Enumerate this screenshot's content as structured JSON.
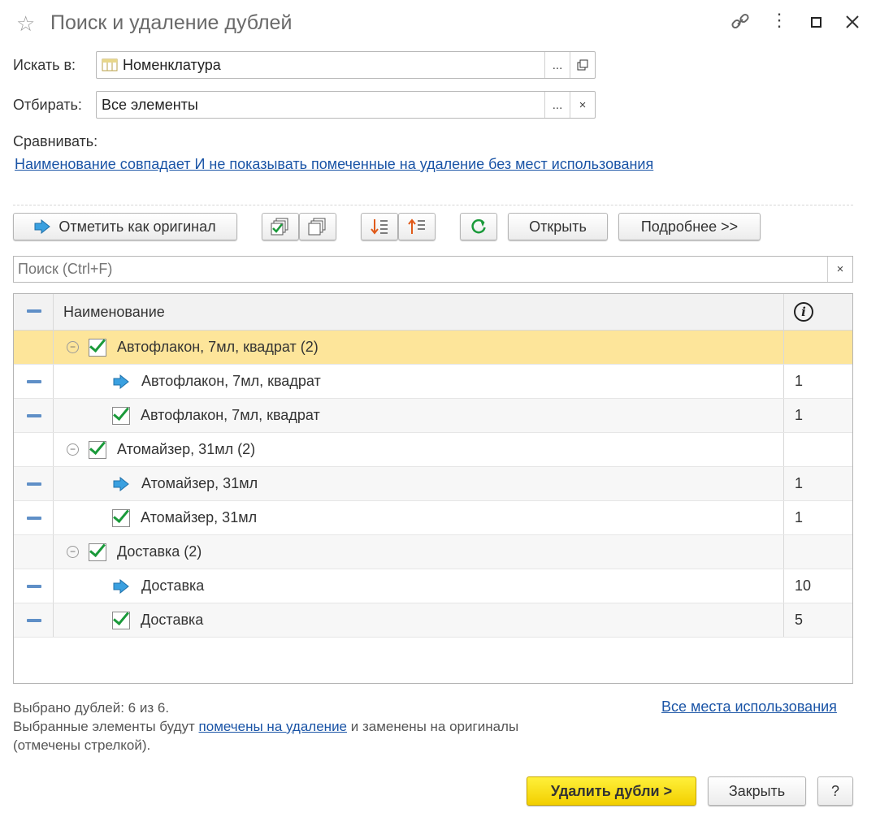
{
  "window": {
    "title": "Поиск и удаление дублей"
  },
  "search_in": {
    "label": "Искать в:",
    "value": "Номенклатура",
    "select_btn": "..."
  },
  "filter": {
    "label": "Отбирать:",
    "value": "Все элементы",
    "select_btn": "...",
    "clear_btn": "×"
  },
  "compare": {
    "label": "Сравнивать:",
    "rule_link": "Наименование совпадает И не показывать помеченные на удаление без мест использования"
  },
  "toolbar": {
    "mark_original": "Отметить как оригинал",
    "open": "Открыть",
    "more": "Подробнее >>"
  },
  "search_box": {
    "placeholder": "Поиск (Ctrl+F)",
    "clear": "×"
  },
  "table": {
    "header_name": "Наименование",
    "rows": [
      {
        "kind": "group",
        "text": "Автофлакон, 7мл, квадрат (2)",
        "count": ""
      },
      {
        "kind": "original",
        "text": "Автофлакон, 7мл, квадрат",
        "count": "1"
      },
      {
        "kind": "duplicate",
        "text": "Автофлакон, 7мл, квадрат",
        "count": "1"
      },
      {
        "kind": "group",
        "text": "Атомайзер, 31мл (2)",
        "count": ""
      },
      {
        "kind": "original",
        "text": "Атомайзер, 31мл",
        "count": "1"
      },
      {
        "kind": "duplicate",
        "text": "Атомайзер, 31мл",
        "count": "1"
      },
      {
        "kind": "group",
        "text": "Доставка (2)",
        "count": ""
      },
      {
        "kind": "original",
        "text": "Доставка",
        "count": "10"
      },
      {
        "kind": "duplicate",
        "text": "Доставка",
        "count": "5"
      }
    ]
  },
  "footer": {
    "selected": "Выбрано дублей: 6 из 6.",
    "info_prefix": "Выбранные элементы будут ",
    "info_link": "помечены на удаление",
    "info_suffix": " и заменены на оригиналы",
    "info_line2": "(отмечены стрелкой).",
    "all_usages_link": "Все места использования"
  },
  "actions": {
    "delete": "Удалить дубли >",
    "close": "Закрыть",
    "help": "?"
  },
  "colors": {
    "selected_row": "#fde59a",
    "primary_button": "#f5d90a",
    "link": "#1a54a6",
    "check_green": "#1a9a3a",
    "arrow_blue": "#3aa0e0"
  }
}
